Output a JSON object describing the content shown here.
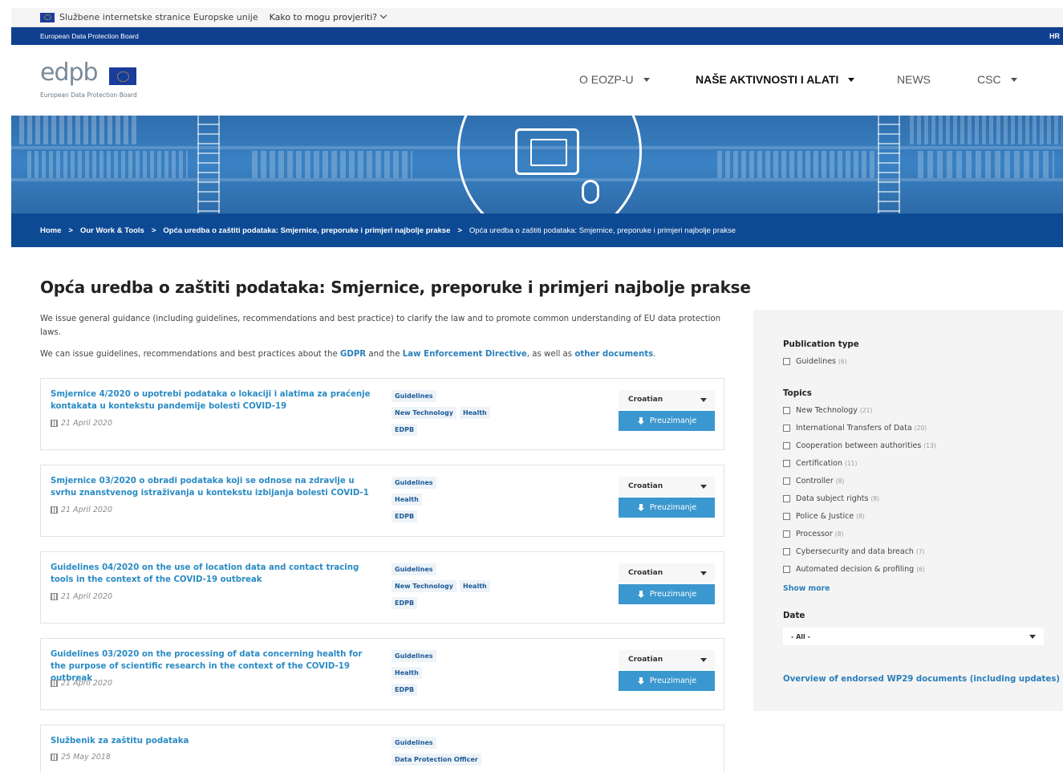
{
  "eu_bar": {
    "site_text": "Službene internetske stranice Europske unije",
    "verify_text": "Kako to mogu provjeriti?"
  },
  "org_bar": {
    "org_name": "European Data Protection Board",
    "language": "HR"
  },
  "header": {
    "logo_text": "edpb",
    "logo_subtitle": "European Data Protection Board",
    "nav": [
      {
        "label": "O EOZP-U"
      },
      {
        "label": "NAŠE AKTIVNOSTI I ALATI"
      },
      {
        "label": "NEWS"
      },
      {
        "label": "CSC"
      }
    ]
  },
  "breadcrumb": {
    "items": [
      "Home",
      "Our Work & Tools",
      "Opća uredba o zaštiti podataka: Smjernice, preporuke i primjeri najbolje prakse"
    ],
    "current": "Opća uredba o zaštiti podataka: Smjernice, preporuke i primjeri najbolje prakse",
    "separator": ">"
  },
  "page": {
    "title": "Opća uredba o zaštiti podataka: Smjernice, preporuke i primjeri najbolje prakse",
    "intro": "We issue general guidance (including guidelines, recommendations and best practice) to clarify the law and to promote common understanding of EU data protection laws.",
    "intro2_a": "We can issue guidelines, recommendations and best practices about the",
    "link_gdpr": "GDPR",
    "intro2_b": "and the",
    "link_led": "Law Enforcement Directive",
    "intro2_c": ", as well as",
    "link_other": "other documents",
    "intro2_d": "."
  },
  "documents": [
    {
      "title": "Smjernice 4/2020 o upotrebi podataka o lokaciji i alatima za praćenje kontakata u kontekstu pandemije bolesti COVID-19",
      "date": "21 April 2020",
      "tag_type": "Guidelines",
      "tag_topic_1": "New Technology",
      "tag_topic_2": "Health",
      "tag_body": "EDPB",
      "language": "Croatian",
      "download_label": "Preuzimanje"
    },
    {
      "title": "Smjernice 03/2020 o obradi podataka koji se odnose na zdravlje u svrhu znanstvenog istraživanja u kontekstu izbijanja bolesti COVID-1",
      "date": "21 April 2020",
      "tag_type": "Guidelines",
      "tag_topic_1": "Health",
      "tag_body": "EDPB",
      "language": "Croatian",
      "download_label": "Preuzimanje"
    },
    {
      "title": "Guidelines 04/2020 on the use of location data and contact tracing tools in the context of the COVID-19 outbreak",
      "date": "21 April 2020",
      "tag_type": "Guidelines",
      "tag_topic_1": "New Technology",
      "tag_topic_2": "Health",
      "tag_body": "EDPB",
      "language": "Croatian",
      "download_label": "Preuzimanje"
    },
    {
      "title": "Guidelines 03/2020 on the processing of data concerning health for the purpose of scientific research in the context of the COVID-19 outbreak",
      "date": "21 April 2020",
      "tag_type": "Guidelines",
      "tag_topic_1": "Health",
      "tag_body": "EDPB",
      "language": "Croatian",
      "download_label": "Preuzimanje"
    },
    {
      "title": "Službenik za zaštitu podataka",
      "date": "25 May 2018",
      "tag_type": "Guidelines",
      "tag_topic_1": "Data Protection Officer"
    }
  ],
  "sidebar": {
    "publication_heading": "Publication type",
    "publication_options": [
      {
        "label": "Guidelines",
        "count": "(6)"
      }
    ],
    "topics_heading": "Topics",
    "topics": [
      {
        "label": "New Technology",
        "count": "(21)"
      },
      {
        "label": "International Transfers of Data",
        "count": "(20)"
      },
      {
        "label": "Cooperation between authorities",
        "count": "(13)"
      },
      {
        "label": "Certification",
        "count": "(11)"
      },
      {
        "label": "Controller",
        "count": "(8)"
      },
      {
        "label": "Data subject rights",
        "count": "(8)"
      },
      {
        "label": "Police & Justice",
        "count": "(8)"
      },
      {
        "label": "Processor",
        "count": "(8)"
      },
      {
        "label": "Cybersecurity and data breach",
        "count": "(7)"
      },
      {
        "label": "Automated decision & profiling",
        "count": "(6)"
      }
    ],
    "show_more": "Show more",
    "date_heading": "Date",
    "date_value": "- All -",
    "overview_link": "Overview of endorsed WP29 documents (including updates)"
  }
}
